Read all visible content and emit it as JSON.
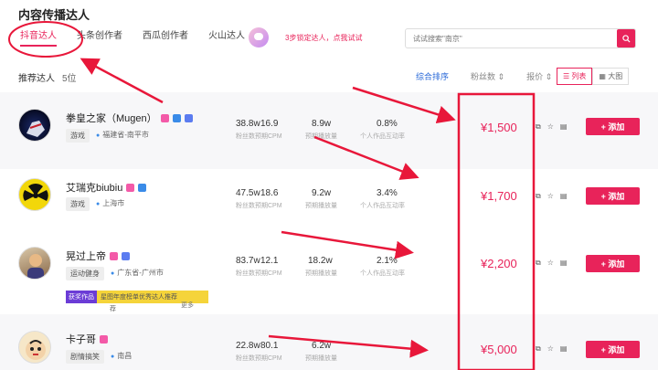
{
  "page": {
    "title": "内容传播达人"
  },
  "tabs": [
    {
      "label": "抖音达人",
      "active": true
    },
    {
      "label": "头条创作者",
      "active": false
    },
    {
      "label": "西瓜创作者",
      "active": false
    },
    {
      "label": "火山达人",
      "active": false
    }
  ],
  "promo": {
    "text": "3步锁定达人，点我试试"
  },
  "search": {
    "placeholder": "试试搜索\"南京\"",
    "button_icon": "search-icon"
  },
  "recommend": {
    "label": "推荐达人",
    "count": "5位"
  },
  "sort": {
    "options": [
      "综合排序",
      "粉丝数 ⇕",
      "报价 ⇕"
    ],
    "active": "综合排序"
  },
  "view": {
    "list_label": "列表",
    "grid_label": "大图"
  },
  "stat_labels": {
    "fans": "粉丝数",
    "cpm": "预期CPM",
    "plays": "预期播放量",
    "interaction": "个人作品互动率"
  },
  "add_label": "+ 添加",
  "rows": [
    {
      "name": "拳皇之家（Mugen）",
      "tag": "游戏",
      "location": "福建省-南平市",
      "fans": "38.8w",
      "cpm": "16.9",
      "plays": "8.9w",
      "interaction": "0.8%",
      "price": "¥1,500"
    },
    {
      "name": "艾瑞克biubiu",
      "tag": "游戏",
      "location": "上海市",
      "fans": "47.5w",
      "cpm": "18.6",
      "plays": "9.2w",
      "interaction": "3.4%",
      "price": "¥1,700"
    },
    {
      "name": "晃过上帝",
      "tag": "运动健身",
      "location": "广东省-广州市",
      "fans": "83.7w",
      "cpm": "12.1",
      "plays": "18.2w",
      "interaction": "2.1%",
      "price": "¥2,200"
    },
    {
      "name": "卡子哥",
      "tag": "剧情搞笑",
      "location": "南昌",
      "fans": "22.8w",
      "cpm": "80.1",
      "plays": "6.2w",
      "interaction": "",
      "price": "¥5,000"
    }
  ],
  "banner": {
    "badge": "获奖作品",
    "text": "星图年度榜单优秀达人推荐",
    "sub": "荐",
    "more": "更多"
  },
  "annotation_color": "#e8173a"
}
